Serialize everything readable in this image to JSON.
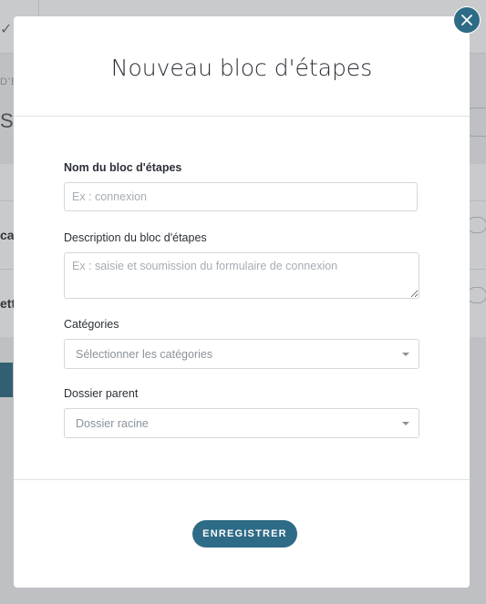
{
  "modal": {
    "title": "Nouveau bloc d'étapes",
    "name_field": {
      "label": "Nom du bloc d'étapes",
      "placeholder": "Ex : connexion",
      "value": ""
    },
    "description_field": {
      "label": "Description du bloc d'étapes",
      "placeholder": "Ex : saisie et soumission du formulaire de connexion",
      "value": ""
    },
    "categories_field": {
      "label": "Catégories",
      "selected": "Sélectionner les catégories"
    },
    "parent_field": {
      "label": "Dossier parent",
      "selected": "Dossier racine"
    },
    "save_label": "ENREGISTRER",
    "close_icon": "close-icon"
  },
  "colors": {
    "accent": "#2e6b86",
    "overlay": "#c7cacd",
    "modal_bg": "#ffffff"
  }
}
